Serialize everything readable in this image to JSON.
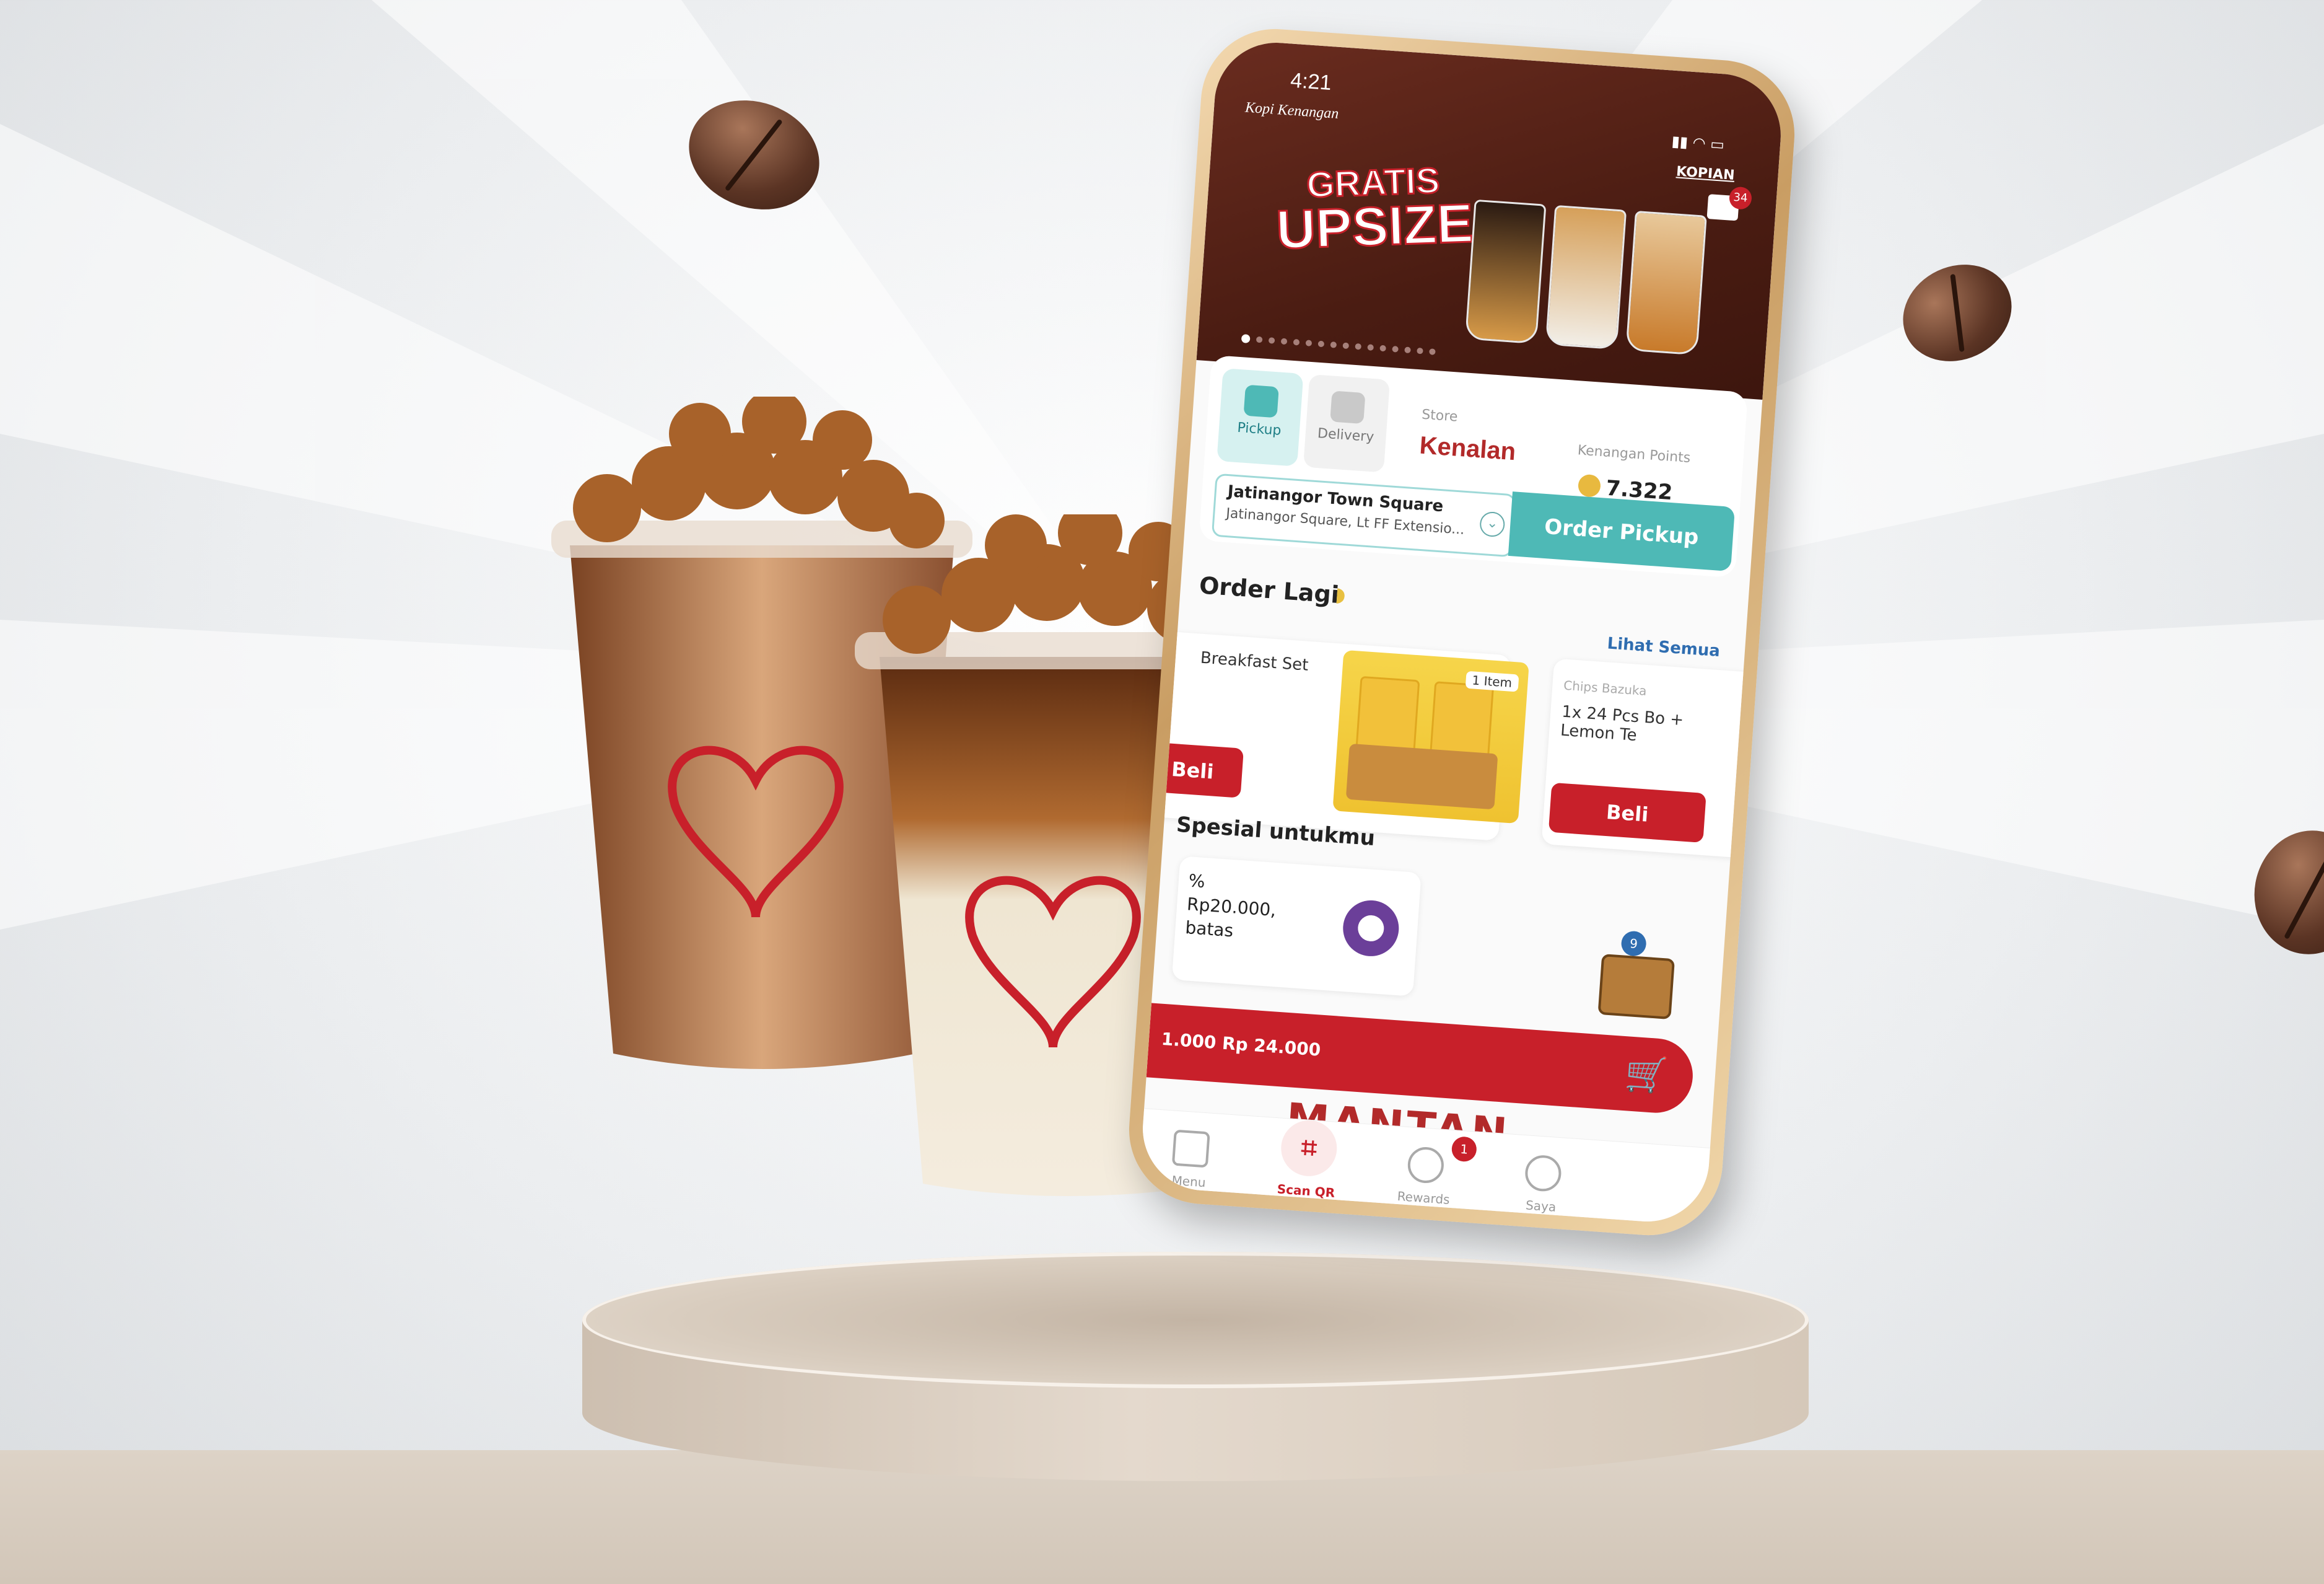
{
  "status": {
    "time": "4:21"
  },
  "brand": {
    "left": "Kopi Kenangan",
    "right": "KOPIAN"
  },
  "notification": {
    "count": "34"
  },
  "banner": {
    "headline_top": "GRATIS",
    "headline_bottom": "UPSIZE",
    "slide_count": 16,
    "active_slide": 0
  },
  "order_mode": {
    "tabs": [
      {
        "label": "Pickup",
        "active": true
      },
      {
        "label": "Delivery",
        "active": false
      }
    ],
    "store_label": "Store",
    "store_name": "Kenalan",
    "points_label": "Kenangan Points",
    "points_value": "7.322",
    "address_line1": "Jatinangor Town Square",
    "address_line2": "Jatinangor Square, Lt FF Extensio...",
    "cta": "Order Pickup"
  },
  "order_again": {
    "title": "Order Lagi",
    "see_all": "Lihat Semua",
    "items": [
      {
        "title": "Breakfast Set",
        "button": "Beli"
      },
      {
        "qty": "1 Item"
      },
      {
        "category": "Chips Bazuka",
        "title": "1x 24 Pcs Bo + Lemon Te",
        "button": "Beli"
      }
    ]
  },
  "special": {
    "title": "Spesial untukmu",
    "voucher_line1": "%",
    "voucher_line2": "Rp20.000,",
    "voucher_line3": "batas",
    "chest_badge": "9"
  },
  "cart": {
    "price": "1.000 Rp 24.000"
  },
  "promo_strip": {
    "text": "MANTAN"
  },
  "bottom_nav": [
    {
      "label": "Menu"
    },
    {
      "label": "Scan QR"
    },
    {
      "label": "Rewards",
      "badge": "1"
    },
    {
      "label": "Saya"
    }
  ],
  "colors": {
    "brand_red": "#c8202a",
    "teal": "#4eb9b6",
    "banner_brown": "#4a1c12"
  }
}
